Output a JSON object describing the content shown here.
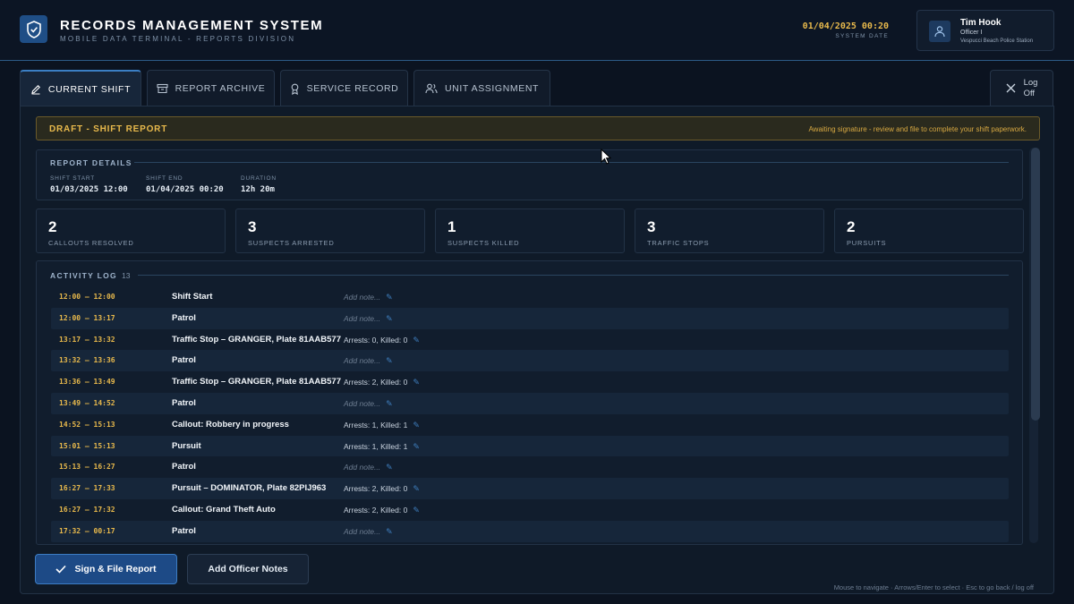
{
  "header": {
    "title": "RECORDS MANAGEMENT SYSTEM",
    "subtitle": "MOBILE DATA TERMINAL - REPORTS DIVISION",
    "system_date_value": "01/04/2025 00:20",
    "system_date_label": "SYSTEM DATE",
    "user": {
      "name": "Tim Hook",
      "rank": "Officer I",
      "station": "Vespucci Beach Police Station"
    }
  },
  "tabs": [
    {
      "label": "CURRENT SHIFT",
      "icon": "pencil-icon",
      "active": true
    },
    {
      "label": "REPORT ARCHIVE",
      "icon": "archive-box-icon",
      "active": false
    },
    {
      "label": "SERVICE RECORD",
      "icon": "award-ribbon-icon",
      "active": false
    },
    {
      "label": "UNIT ASSIGNMENT",
      "icon": "users-icon",
      "active": false
    }
  ],
  "logoff": {
    "label_line1": "Log",
    "label_line2": "Off"
  },
  "draft": {
    "title": "DRAFT - SHIFT REPORT",
    "message": "Awaiting signature - review and file to complete your shift paperwork."
  },
  "details": {
    "title": "REPORT DETAILS",
    "shift_start_label": "SHIFT START",
    "shift_start_value": "01/03/2025 12:00",
    "shift_end_label": "SHIFT END",
    "shift_end_value": "01/04/2025 00:20",
    "duration_label": "DURATION",
    "duration_value": "12h 20m"
  },
  "stats": [
    {
      "value": "2",
      "label": "CALLOUTS RESOLVED"
    },
    {
      "value": "3",
      "label": "SUSPECTS ARRESTED"
    },
    {
      "value": "1",
      "label": "SUSPECTS KILLED"
    },
    {
      "value": "3",
      "label": "TRAFFIC STOPS"
    },
    {
      "value": "2",
      "label": "PURSUITS"
    }
  ],
  "activity_log": {
    "title": "ACTIVITY LOG",
    "count": "13",
    "rows": [
      {
        "time": "12:00 – 12:00",
        "activity": "Shift Start",
        "note": "Add note...",
        "placeholder": true
      },
      {
        "time": "12:00 – 13:17",
        "activity": "Patrol",
        "note": "Add note...",
        "placeholder": true
      },
      {
        "time": "13:17 – 13:32",
        "activity": "Traffic Stop – GRANGER, Plate 81AAB577",
        "note": "Arrests: 0, Killed: 0",
        "placeholder": false
      },
      {
        "time": "13:32 – 13:36",
        "activity": "Patrol",
        "note": "Add note...",
        "placeholder": true
      },
      {
        "time": "13:36 – 13:49",
        "activity": "Traffic Stop – GRANGER, Plate 81AAB577",
        "note": "Arrests: 2, Killed: 0",
        "placeholder": false
      },
      {
        "time": "13:49 – 14:52",
        "activity": "Patrol",
        "note": "Add note...",
        "placeholder": true
      },
      {
        "time": "14:52 – 15:13",
        "activity": "Callout: Robbery in progress",
        "note": "Arrests: 1, Killed: 1",
        "placeholder": false
      },
      {
        "time": "15:01 – 15:13",
        "activity": "Pursuit",
        "note": "Arrests: 1, Killed: 1",
        "placeholder": false
      },
      {
        "time": "15:13 – 16:27",
        "activity": "Patrol",
        "note": "Add note...",
        "placeholder": true
      },
      {
        "time": "16:27 – 17:33",
        "activity": "Pursuit – DOMINATOR, Plate 82PIJ963",
        "note": "Arrests: 2, Killed: 0",
        "placeholder": false
      },
      {
        "time": "16:27 – 17:32",
        "activity": "Callout: Grand Theft Auto",
        "note": "Arrests: 2, Killed: 0",
        "placeholder": false
      },
      {
        "time": "17:32 – 00:17",
        "activity": "Patrol",
        "note": "Add note...",
        "placeholder": true
      }
    ]
  },
  "actions": {
    "sign_label": "Sign & File Report",
    "notes_label": "Add Officer Notes"
  },
  "hint": "Mouse to navigate · Arrows/Enter to select · Esc to go back / log off",
  "colors": {
    "accent_blue": "#3b7fc4",
    "warning_amber": "#e8b94c",
    "background": "#0b1320"
  }
}
